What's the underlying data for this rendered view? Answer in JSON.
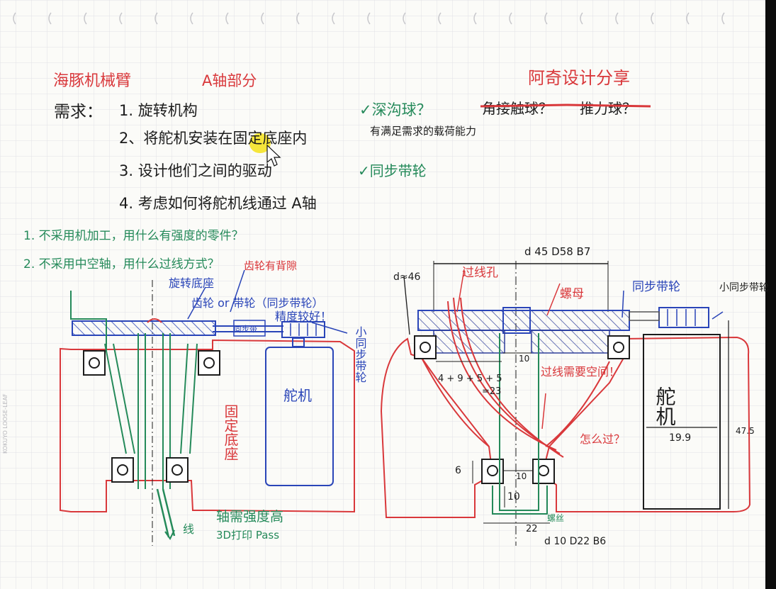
{
  "title": {
    "left": "海豚机械臂",
    "part": "A轴部分",
    "right": "阿奇设计分享"
  },
  "requirements": {
    "label": "需求：",
    "items": [
      "1. 旋转机构",
      "2、将舵机安装在固定底座内",
      "3. 设计他们之间的驱动",
      "4. 考虑如何将舵机线通过 A轴"
    ]
  },
  "bearing_choice": {
    "deep_groove": "✓深沟球？",
    "angular_contact": "角接触球？",
    "thrust": "推力球？",
    "note": "有满足需求的载荷能力"
  },
  "drive_choice": "✓同步带轮",
  "questions": [
    "1. 不采用机加工，用什么有强度的零件？",
    "2. 不采用中空轴，用什么过线方式？"
  ],
  "left_sketch": {
    "gear_gap": "齿轮有背隙",
    "rotating_base": "旋转底座",
    "gear_or_pulley": "齿轮 or 带轮（同步带轮）",
    "precision": "精度较好！",
    "sync_belt": "同步带",
    "small_pulley": "小同步带轮",
    "servo": "舵机",
    "fixed_base": "固定底座",
    "wire": "线",
    "shaft_note": "轴需强度高",
    "print_note": "3D打印 Pass"
  },
  "right_sketch": {
    "dim_top": "d 45  D58  B7",
    "dim_d": "d≈46",
    "wire_hole": "过线孔",
    "nut": "螺母",
    "sync_pulley": "同步带轮",
    "small_pulley": "小同步带轮",
    "wire_space": "过线需要空间！",
    "how_wire": "怎么过？",
    "dims_sum": "4 + 9 + 5 + 5",
    "dims_total": "=23",
    "dim_10a": "10",
    "dim_10b": "10",
    "dim_10c": "10",
    "dim_6": "6",
    "dim_22": "22",
    "dim_475": "47.5",
    "dim_199": "19.9",
    "servo": "舵机",
    "screw": "螺丝",
    "bearing_bottom": "d 10  D22  B6"
  },
  "colors": {
    "red": "#d9383b",
    "black": "#1c1c1c",
    "green": "#258a5a",
    "blue": "#2a45b8",
    "highlight": "#f4e21a",
    "paper": "#fbfbf8",
    "grid": "#e2e2e6"
  }
}
